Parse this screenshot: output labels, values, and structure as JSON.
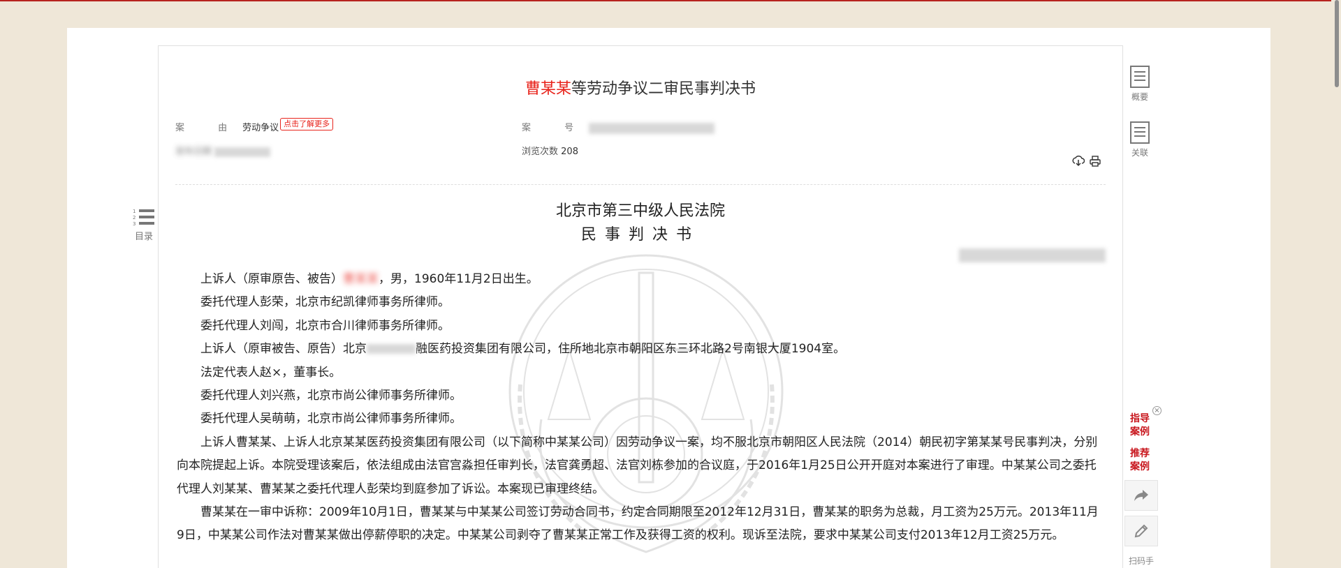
{
  "document": {
    "title_name": "曹某某",
    "title_rest": "等劳动争议二审民事判决书",
    "meta": {
      "cause_label": "案 由",
      "cause_value": "劳动争议",
      "more_tag": "点击了解更多",
      "case_label": "案 号",
      "publish_label": "发布日期",
      "views_label": "浏览次数",
      "views_value": "208"
    },
    "court": "北京市第三中级人民法院",
    "doc_type": "民事判决书"
  },
  "paragraphs": [
    {
      "pre": "上诉人（原审原告、被告）",
      "red": "曹某某",
      "post": "，男，1960年11月2日出生。"
    },
    {
      "pre": "委托代理人彭荣，北京市纪凯律师事务所律师。",
      "red": "",
      "post": ""
    },
    {
      "pre": "委托代理人刘闯，北京市合川律师事务所律师。",
      "red": "",
      "post": ""
    },
    {
      "pre": "上诉人（原审被告、原告）北京",
      "red": "",
      "post": "融医药投资集团有限公司，住所地北京市朝阳区东三环北路2号南银大厦1904室。"
    },
    {
      "pre": "法定代表人赵×，董事长。",
      "red": "",
      "post": ""
    },
    {
      "pre": "委托代理人刘兴燕，北京市尚公律师事务所律师。",
      "red": "",
      "post": ""
    },
    {
      "pre": "委托代理人吴萌萌，北京市尚公律师事务所律师。",
      "red": "",
      "post": ""
    }
  ],
  "long_paragraphs": [
    "上诉人曹某某、上诉人北京某某医药投资集团有限公司（以下简称中某某公司）因劳动争议一案，均不服北京市朝阳区人民法院（2014）朝民初字第某某号民事判决，分别向本院提起上诉。本院受理该案后，依法组成由法官宫淼担任审判长，法官龚勇超、法官刘栋参加的合议庭，于2016年1月25日公开开庭对本案进行了审理。中某某公司之委托代理人刘某某、曹某某之委托代理人彭荣均到庭参加了诉讼。本案现已审理终结。",
    "曹某某在一审中诉称：2009年10月1日，曹某某与中某某公司签订劳动合同书，约定合同期限至2012年12月31日，曹某某的职务为总裁，月工资为25万元。2013年11月9日，中某某公司作法对曹某某做出停薪停职的决定。中某某公司剥夺了曹某某正常工作及获得工资的权利。现诉至法院，要求中某某公司支付2013年12月工资25万元。"
  ],
  "toc": {
    "label": "目录"
  },
  "sidebar": {
    "summary": "概要",
    "related": "关联",
    "guide_line1": "指导",
    "guide_line2": "案例",
    "recommend_line1": "推荐",
    "recommend_line2": "案例",
    "scan": "扫码手"
  },
  "colors": {
    "accent": "#c8161d",
    "highlight": "#e8231b",
    "background": "#efe7d8"
  }
}
